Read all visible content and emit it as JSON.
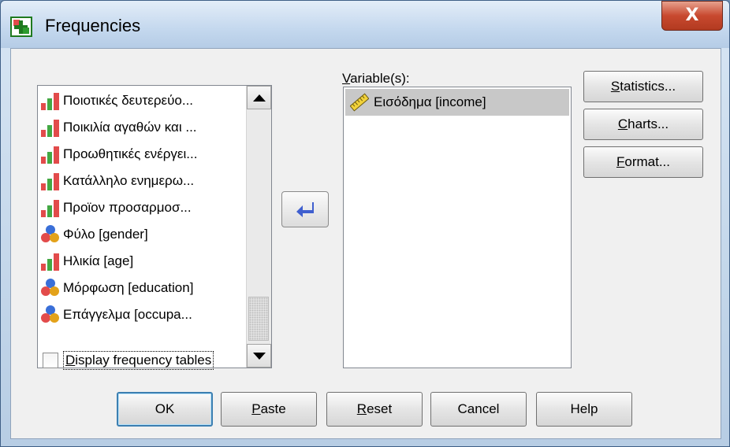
{
  "window": {
    "title": "Frequencies",
    "close_label": "X"
  },
  "source_list": {
    "items": [
      {
        "label": "Ποιοτικές δευτερεύο...",
        "icon": "ordinal-bar-icon"
      },
      {
        "label": "Ποικιλία αγαθών και ...",
        "icon": "ordinal-bar-icon"
      },
      {
        "label": "Προωθητικές ενέργει...",
        "icon": "ordinal-bar-icon"
      },
      {
        "label": "Κατάλληλο ενημερω...",
        "icon": "ordinal-bar-icon"
      },
      {
        "label": "Προϊον προσαρμοσ...",
        "icon": "ordinal-bar-icon"
      },
      {
        "label": "Φύλο  [gender]",
        "icon": "nominal-circles-icon"
      },
      {
        "label": "Ηλικία [age]",
        "icon": "ordinal-bar-icon"
      },
      {
        "label": "Μόρφωση [education]",
        "icon": "nominal-circles-icon"
      },
      {
        "label": "Επάγγελμα [occupa...",
        "icon": "nominal-circles-icon"
      }
    ]
  },
  "target": {
    "label_prefix": "V",
    "label_rest": "ariable(s):",
    "items": [
      {
        "label": "Εισόδημα [income]",
        "icon": "scale-ruler-icon"
      }
    ]
  },
  "side_buttons": {
    "statistics": {
      "key": "S",
      "rest": "tatistics..."
    },
    "charts": {
      "key": "C",
      "rest": "harts..."
    },
    "format": {
      "key": "F",
      "rest": "ormat..."
    }
  },
  "checkbox": {
    "key": "D",
    "rest": "isplay frequency tables",
    "checked": false
  },
  "bottom_buttons": {
    "ok": "OK",
    "paste_key": "P",
    "paste_rest": "aste",
    "reset_key": "R",
    "reset_rest": "eset",
    "cancel": "Cancel",
    "help": "Help"
  },
  "colors": {
    "accent": "#3c7fb1",
    "close": "#c8492f",
    "move_arrow": "#3f5fcf"
  }
}
